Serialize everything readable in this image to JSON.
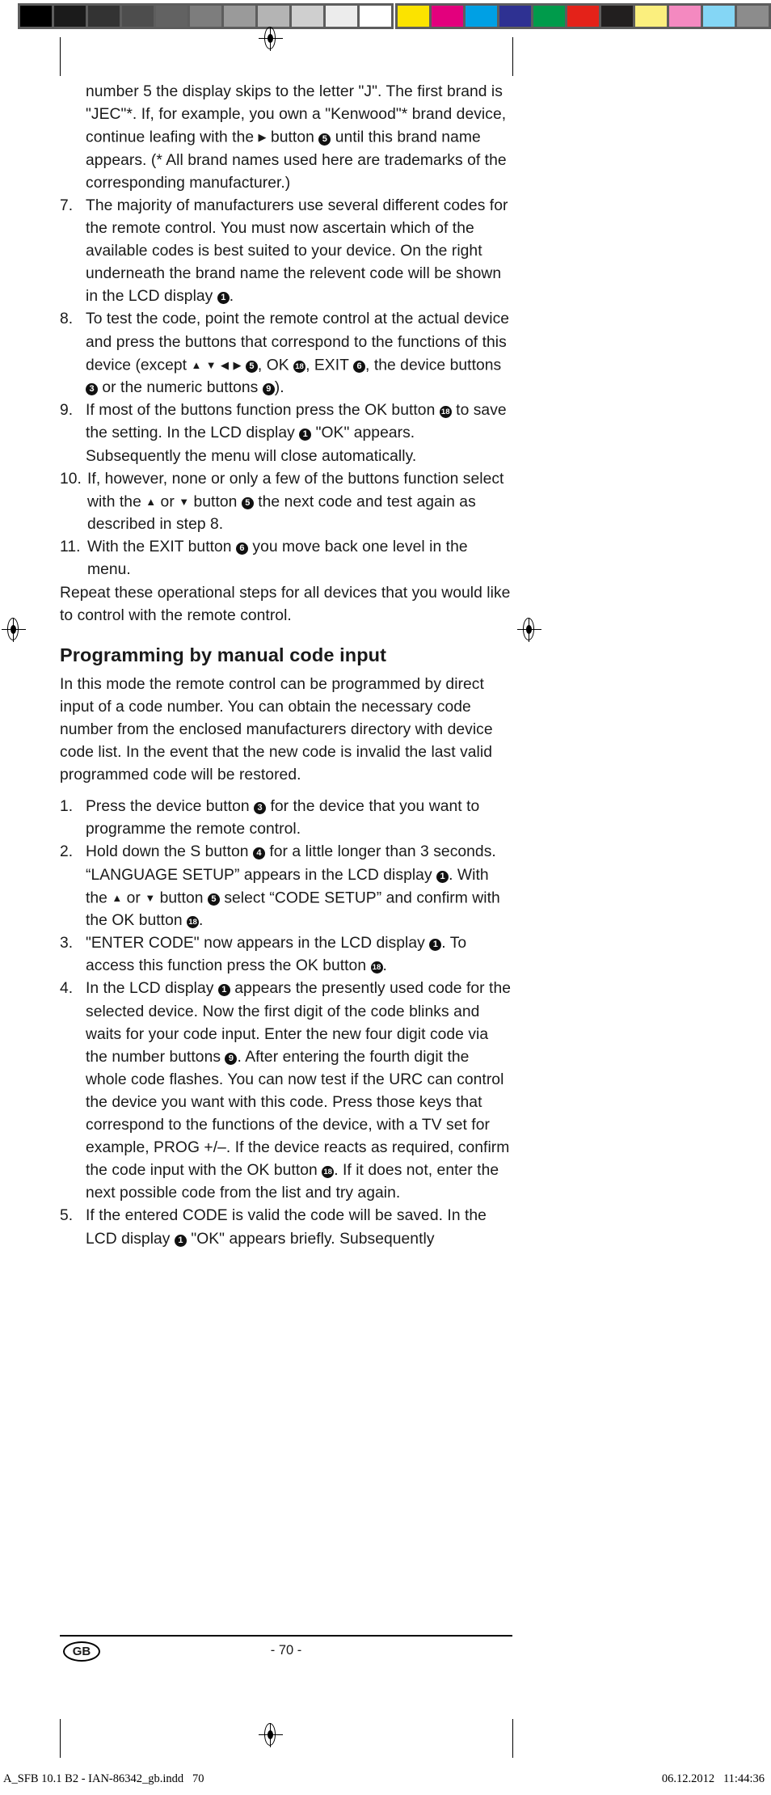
{
  "calibration": {
    "gray_swatches": [
      "#000000",
      "#1b1b1b",
      "#333333",
      "#4d4d4d",
      "#626262",
      "#7d7d7d",
      "#9a9a9a",
      "#b4b4b4",
      "#cfcfcf",
      "#ececec",
      "#ffffff"
    ],
    "color_swatches": [
      "#fbe300",
      "#e3007d",
      "#00a0e4",
      "#2e3192",
      "#009b4b",
      "#e42219",
      "#221f1f",
      "#fbef7e",
      "#f489c0",
      "#84d6f5",
      "#8c8c8c"
    ],
    "strip_background": "#5d5d5d"
  },
  "body": {
    "continued_paragraph": {
      "part1": "number 5 the display skips to the letter \"J\". The first brand is \"JEC\"*. If, for example, you own a \"Kenwood\"* brand device, continue leafing with the ",
      "arrow_right": "▶",
      "part2": " button ",
      "badge5": "5",
      "part3": " until this brand name appears. (* All brand names used here are trademarks of the corresponding manufacturer.)"
    },
    "steps": [
      {
        "num": "7.",
        "part1": "The majority of manufacturers use several different codes for the remote control. You must now ascertain which of the available codes is best suited to your device. On the right underneath the brand name the relevent code will be shown in the LCD display ",
        "badge1": "1",
        "part2": "."
      },
      {
        "num": "8.",
        "part1": "To test the code, point the remote control at the actual device and press the buttons  that correspond to the functions of this device (except ",
        "arrow_up": "▲",
        "arrow_down": "▼",
        "arrow_left": "◀",
        "arrow_right": "▶",
        "badge5": "5",
        "part2": ", OK ",
        "badge18": "18",
        "part3": ", EXIT ",
        "badge6": "6",
        "part4": ", the device buttons ",
        "badge3": "3",
        "part5": " or the numeric buttons ",
        "badge9": "9",
        "part6": ")."
      },
      {
        "num": "9.",
        "part1": "If most of the buttons function press the OK button ",
        "badge18": "18",
        "part2": " to save the setting. In the LCD display ",
        "badge1": "1",
        "part3": " \"OK\" appears. Subsequently the menu will close automatically."
      },
      {
        "num": "10.",
        "part1": "If, however, none or only a few of the buttons function select with the ",
        "arrow_up": "▲",
        "mid": " or ",
        "arrow_down": "▼",
        "part2": " button ",
        "badge5": "5",
        "part3": " the next code and test again as described in step 8."
      },
      {
        "num": "11.",
        "part1": "With the EXIT button ",
        "badge6": "6",
        "part2": " you move back one level in the menu."
      }
    ],
    "after_steps": "Repeat these operational steps for all devices that you would like to control with the remote control.",
    "section_heading": "Programming by manual code input",
    "intro_paragraph": "In this mode the remote control can be programmed by direct input of a code number. You can obtain the necessary code number from the enclosed manufacturers directory with device code list. In the event that the new code is invalid the last valid programmed code will be restored.",
    "manual_steps": [
      {
        "num": "1.",
        "part1": "Press the device button ",
        "badge3": "3",
        "part2": " for the device that you want to programme the remote control."
      },
      {
        "num": "2.",
        "part1": "Hold down the S button ",
        "badge4": "4",
        "part2": " for a little longer than 3 seconds. “LANGUAGE SETUP” appears in the LCD display ",
        "badge1": "1",
        "part3": ". With the ",
        "arrow_up": "▲",
        "mid": " or ",
        "arrow_down": "▼",
        "part4": " button ",
        "badge5": "5",
        "part5": " select “CODE SETUP” and confirm with the OK button ",
        "badge18": "18",
        "part6": "."
      },
      {
        "num": "3.",
        "part1": "\"ENTER CODE\" now appears in the LCD display ",
        "badge1": "1",
        "part2": ".  To access this function press the OK button ",
        "badge18": "18",
        "part3": "."
      },
      {
        "num": "4.",
        "part1": "In the LCD display ",
        "badge1": "1",
        "part2": " appears the presently used code for the selected device. Now the first digit of the code blinks and waits for your code input. Enter the new four digit code via the number buttons ",
        "badge9": "9",
        "part3": ". After entering the fourth digit the whole code flashes. You can now test if the URC can control the device you want with this code. Press those keys that correspond to the functions of the device, with a TV set for example, PROG +/–. If the device reacts as required, confirm the code input with the OK button ",
        "badge18": "18",
        "part4": ". If it does not, enter the next possible code from the list and try again."
      },
      {
        "num": "5.",
        "part1": "If the entered CODE is valid the code will be saved. In the LCD display ",
        "badge1": "1",
        "part2": " \"OK\" appears briefly. Subsequently"
      }
    ]
  },
  "footer": {
    "locale_badge": "GB",
    "page_number": "- 70 -"
  },
  "imprint": {
    "left": "A_SFB 10.1 B2 - IAN-86342_gb.indd   70",
    "right": "06.12.2012   11:44:36"
  }
}
